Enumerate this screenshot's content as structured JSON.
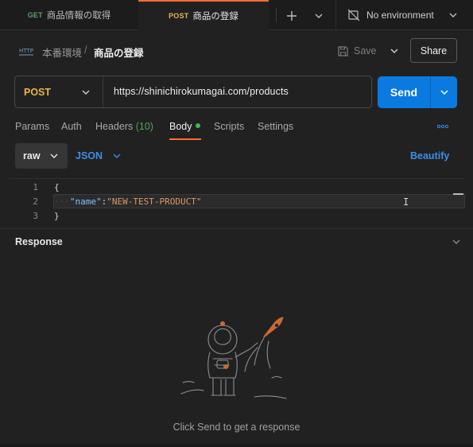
{
  "tabs": [
    {
      "method": "GET",
      "label": "商品情報の取得"
    },
    {
      "method": "POST",
      "label": "商品の登録"
    }
  ],
  "environment": {
    "label": "No environment"
  },
  "breadcrumb": {
    "parent": "本番環境",
    "separator": "/",
    "current": "商品の登録"
  },
  "toolbar": {
    "save_label": "Save",
    "share_label": "Share"
  },
  "request": {
    "method": "POST",
    "url": "https://shinichirokumagai.com/products",
    "send_label": "Send"
  },
  "subtabs": {
    "params": "Params",
    "auth": "Auth",
    "headers": "Headers",
    "headers_count": "(10)",
    "body": "Body",
    "scripts": "Scripts",
    "settings": "Settings"
  },
  "body_options": {
    "mode": "raw",
    "format": "JSON",
    "beautify": "Beautify"
  },
  "editor": {
    "line_numbers": [
      "1",
      "2",
      "3"
    ],
    "line1": "{",
    "line2_key": "\"name\"",
    "line2_colon": ":",
    "line2_value": "\"NEW-TEST-PRODUCT\"",
    "line3": "}"
  },
  "response": {
    "title": "Response",
    "empty_message": "Click Send to get a response"
  },
  "colors": {
    "accent": "#ff6c37",
    "send": "#0b7ae0",
    "post": "#e8b64b",
    "get": "#5f9e6a",
    "link": "#3b8fe8"
  }
}
